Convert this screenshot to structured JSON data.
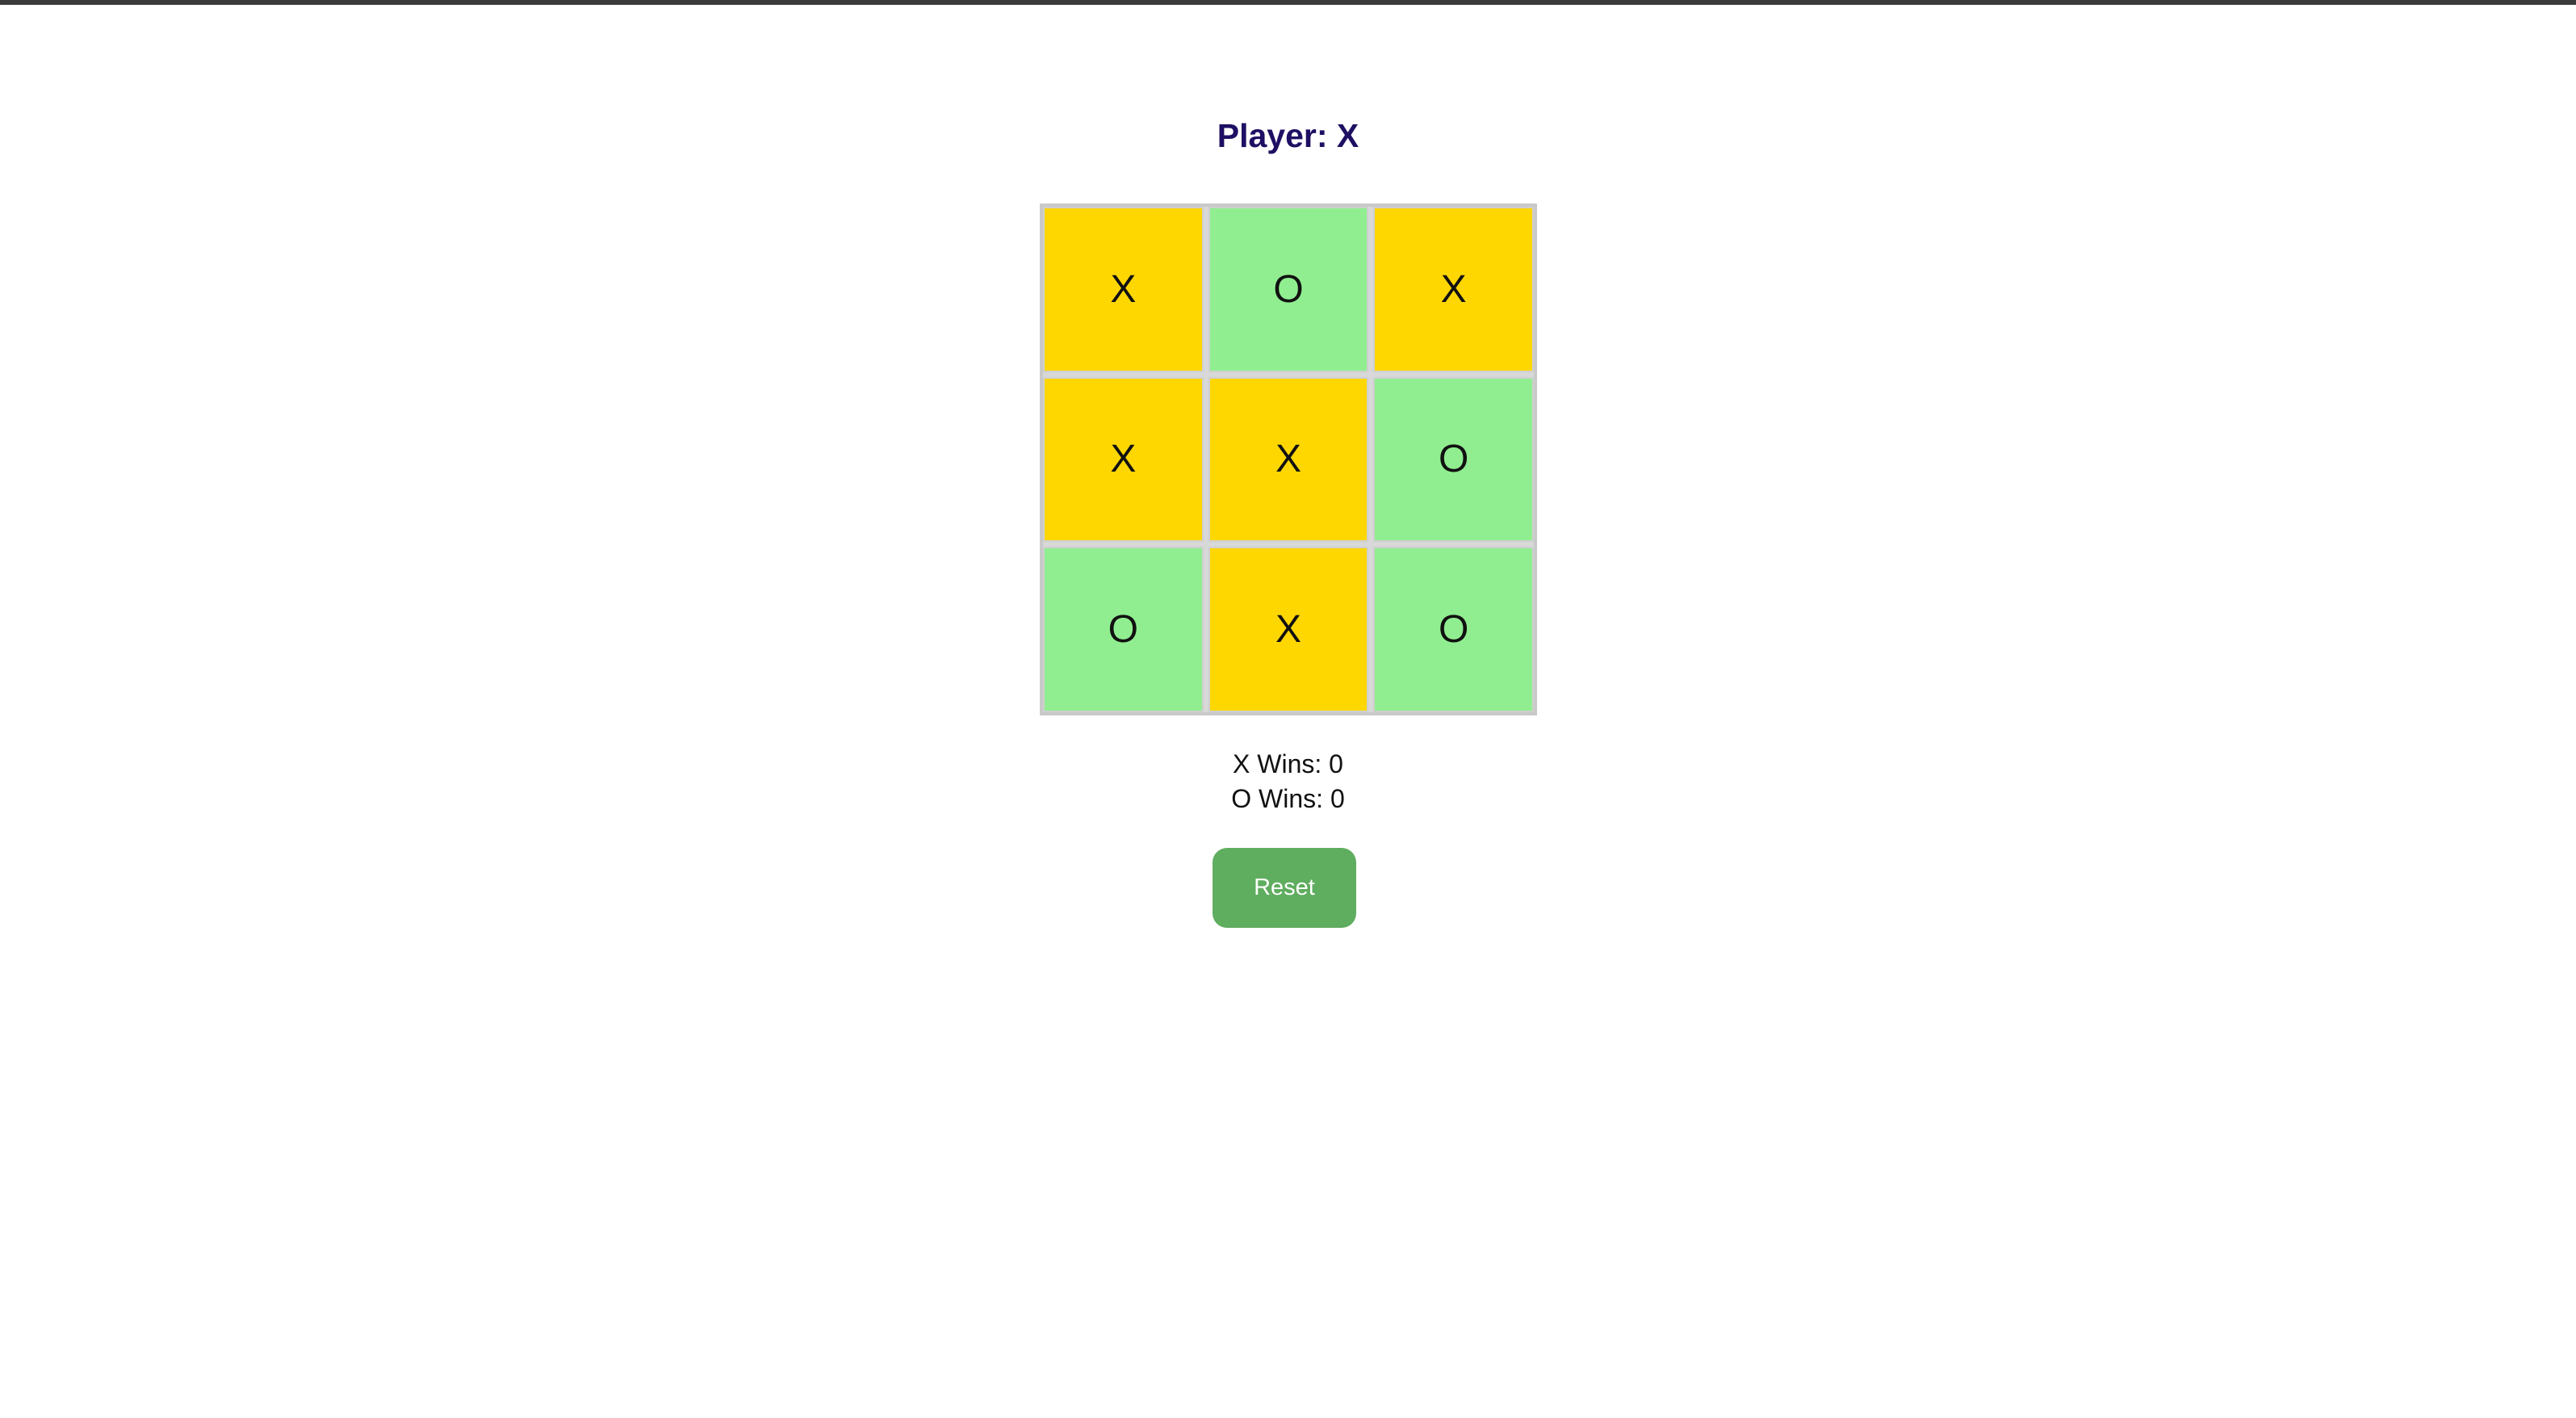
{
  "game": {
    "status": "Player: X",
    "board": [
      [
        "X",
        "O",
        "X"
      ],
      [
        "X",
        "X",
        "O"
      ],
      [
        "O",
        "X",
        "O"
      ]
    ],
    "colors": {
      "x_cell": "#ffd700",
      "o_cell": "#90ee90",
      "heading": "#1f0f63",
      "reset_button": "#5fad5f"
    }
  },
  "scores": {
    "x_wins": "X Wins: 0",
    "o_wins": "O Wins: 0"
  },
  "controls": {
    "reset_label": "Reset"
  }
}
